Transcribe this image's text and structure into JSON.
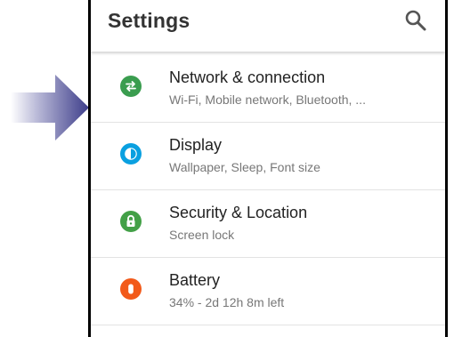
{
  "header": {
    "title": "Settings",
    "search_icon": "search-icon"
  },
  "items": [
    {
      "label": "Network & connection",
      "subtitle": "Wi-Fi, Mobile network, Bluetooth, ...",
      "icon": "swap-arrows-icon",
      "color": "#3a9d4f"
    },
    {
      "label": "Display",
      "subtitle": "Wallpaper, Sleep, Font size",
      "icon": "brightness-icon",
      "color": "#0aa0e0"
    },
    {
      "label": "Security & Location",
      "subtitle": "Screen lock",
      "icon": "lock-icon",
      "color": "#43a047"
    },
    {
      "label": "Battery",
      "subtitle": "34% - 2d 12h 8m left",
      "icon": "battery-icon",
      "color": "#f25a1a"
    }
  ],
  "pointer": {
    "icon": "arrow-right-icon",
    "color": "#3d3d8a"
  }
}
